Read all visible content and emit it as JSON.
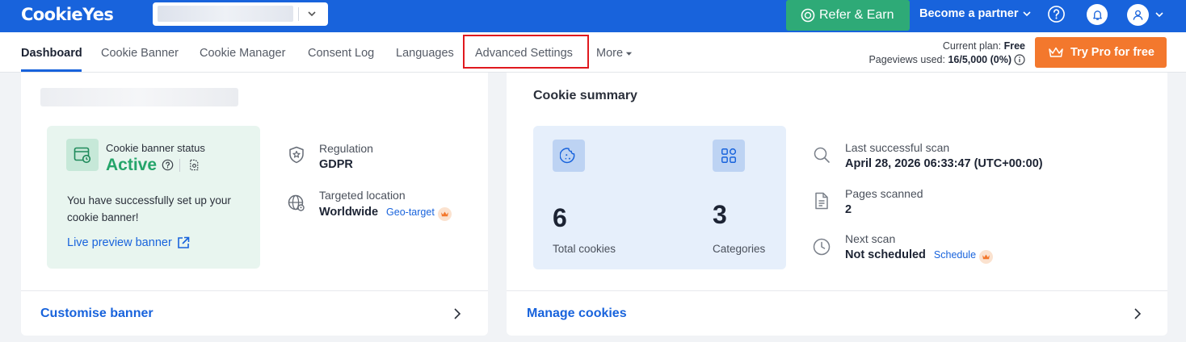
{
  "header": {
    "logo": "CookieYes",
    "refer_label": "Refer & Earn",
    "partner_label": "Become a partner"
  },
  "nav": {
    "tabs": [
      "Dashboard",
      "Cookie Banner",
      "Cookie Manager",
      "Consent Log",
      "Languages",
      "Advanced Settings",
      "More"
    ],
    "active_tab": "Dashboard",
    "highlighted_tab": "Advanced Settings"
  },
  "plan": {
    "label": "Current plan:",
    "name": "Free",
    "pageviews_label": "Pageviews used:",
    "pageviews_value": "16/5,000 (0%)"
  },
  "try_pro_label": "Try Pro for free",
  "banner_card": {
    "status_label": "Cookie banner status",
    "status_value": "Active",
    "message": "You have successfully set up your cookie banner!",
    "preview_link": "Live preview banner",
    "regulation_label": "Regulation",
    "regulation_value": "GDPR",
    "location_label": "Targeted location",
    "location_value": "Worldwide",
    "geo_link": "Geo-target",
    "footer_link": "Customise banner"
  },
  "summary_card": {
    "title": "Cookie summary",
    "total_cookies": "6",
    "total_cookies_label": "Total cookies",
    "categories": "3",
    "categories_label": "Categories",
    "last_scan_label": "Last successful scan",
    "last_scan_value": "April 28, 2026 06:33:47 (UTC+00:00)",
    "pages_label": "Pages scanned",
    "pages_value": "2",
    "next_scan_label": "Next scan",
    "next_scan_value": "Not scheduled",
    "schedule_link": "Schedule",
    "footer_link": "Manage cookies"
  },
  "colors": {
    "brand_blue": "#1863dc",
    "refer_green": "#2eaa77",
    "try_pro_orange": "#f3782d",
    "active_green": "#25a56a",
    "highlight_red": "#e0191e"
  }
}
